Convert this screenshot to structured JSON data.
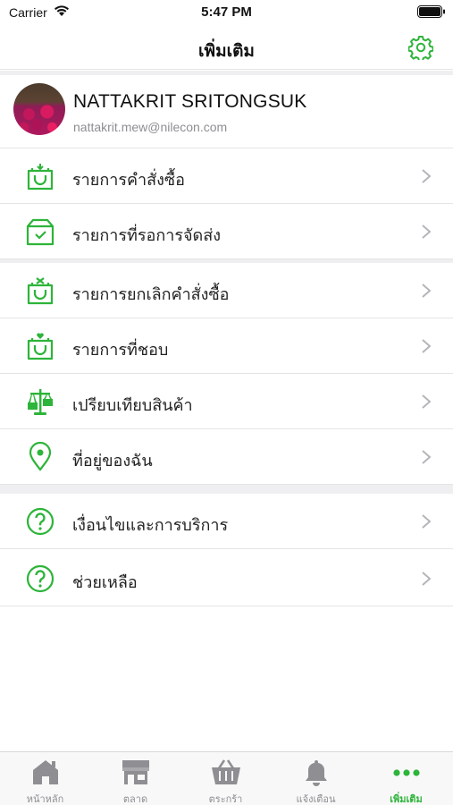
{
  "status_bar": {
    "carrier": "Carrier",
    "time": "5:47 PM"
  },
  "nav": {
    "title": "เพิ่มเติม",
    "settings_icon": "gear-icon"
  },
  "profile": {
    "name": "NATTAKRIT SRITONGSUK",
    "email": "nattakrit.mew@nilecon.com"
  },
  "menu": [
    {
      "label": "รายการคำสั่งซื้อ",
      "icon": "shopping-bag-icon"
    },
    {
      "label": "รายการที่รอการจัดส่ง",
      "icon": "box-check-icon"
    },
    {
      "label": "รายการยกเลิกคำสั่งซื้อ",
      "icon": "bag-cancel-icon"
    },
    {
      "label": "รายการที่ชอบ",
      "icon": "bag-heart-icon"
    },
    {
      "label": "เปรียบเทียบสินค้า",
      "icon": "scale-icon"
    },
    {
      "label": "ที่อยู่ของฉัน",
      "icon": "location-pin-icon"
    },
    {
      "label": "เงื่อนไขและการบริการ",
      "icon": "question-circle-icon"
    },
    {
      "label": "ช่วยเหลือ",
      "icon": "question-circle-icon"
    }
  ],
  "tabs": [
    {
      "label": "หน้าหลัก",
      "icon": "home-icon",
      "active": false
    },
    {
      "label": "ตลาด",
      "icon": "market-icon",
      "active": false
    },
    {
      "label": "ตระกร้า",
      "icon": "basket-icon",
      "active": false
    },
    {
      "label": "แจ้งเตือน",
      "icon": "bell-icon",
      "active": false
    },
    {
      "label": "เพิ่มเติม",
      "icon": "more-dots-icon",
      "active": true
    }
  ],
  "colors": {
    "accent": "#2db43a",
    "inactive": "#8e8e93",
    "separator": "#e4e4e4",
    "section_gap": "#efeff2"
  }
}
